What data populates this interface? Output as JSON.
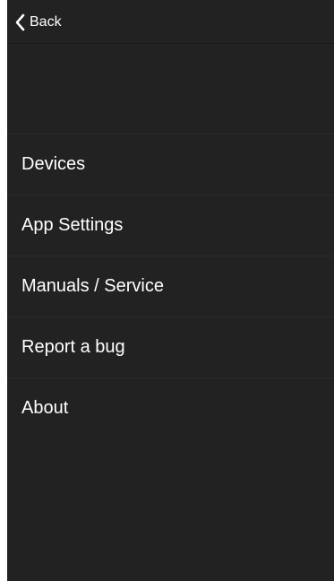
{
  "nav": {
    "back_label": "Back",
    "back_icon": "chevron-left-icon"
  },
  "menu": {
    "items": [
      {
        "label": "Devices"
      },
      {
        "label": "App Settings"
      },
      {
        "label": "Manuals / Service"
      },
      {
        "label": "Report a bug"
      },
      {
        "label": "About"
      }
    ]
  },
  "colors": {
    "background": "#222222",
    "text": "#ffffff",
    "divider": "#2b2b2b"
  }
}
